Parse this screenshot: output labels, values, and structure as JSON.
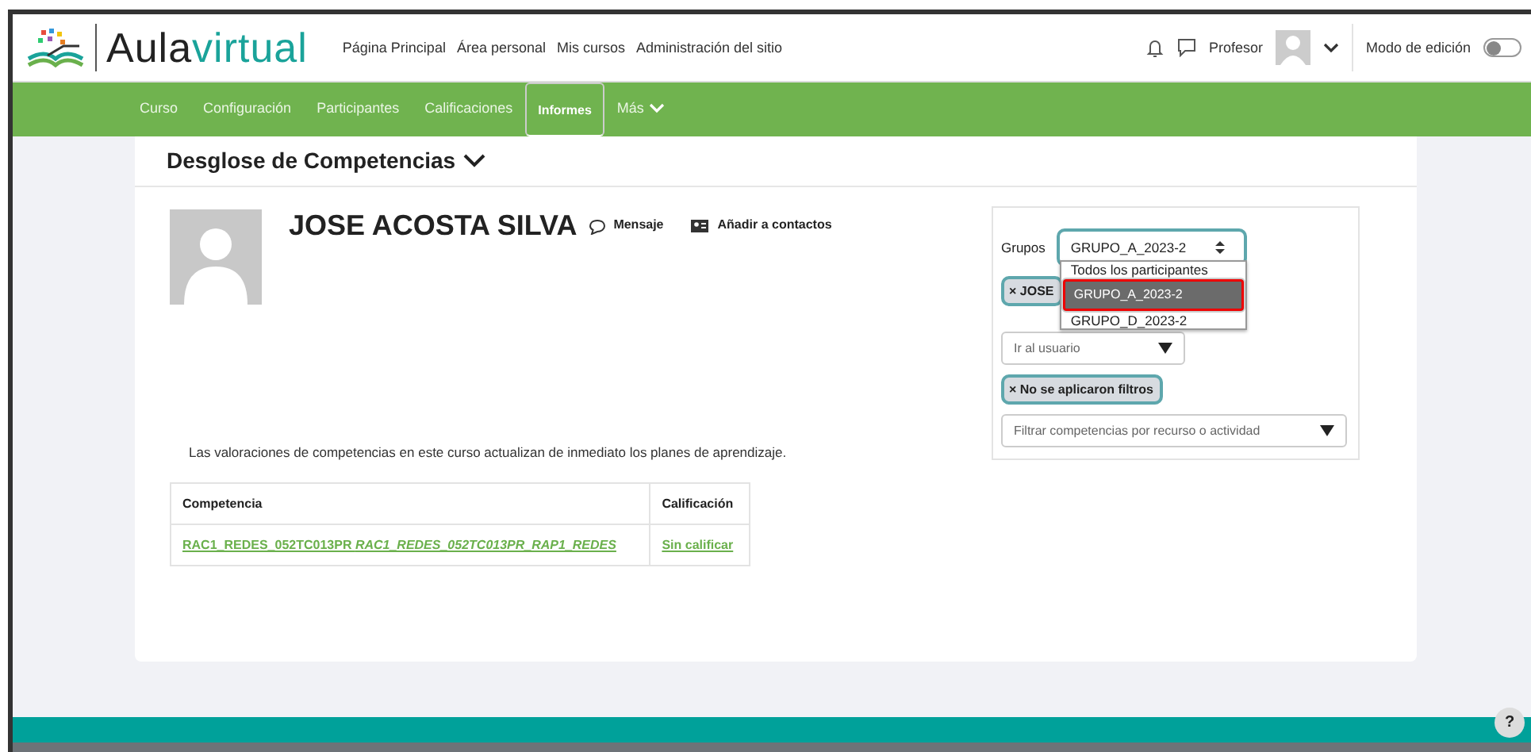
{
  "header": {
    "logo": {
      "part_1": "Aula",
      "part_2": "virtual"
    },
    "nav_links": [
      "Página Principal",
      "Área personal",
      "Mis cursos",
      "Administración del sitio"
    ],
    "user_name": "Profesor",
    "edit_mode": {
      "label": "Modo de edición",
      "on": false
    }
  },
  "course_nav": [
    {
      "label": "Curso",
      "selected": false
    },
    {
      "label": "Configuración",
      "selected": false
    },
    {
      "label": "Participantes",
      "selected": false
    },
    {
      "label": "Calificaciones",
      "selected": false
    },
    {
      "label": "Informes",
      "selected": true
    },
    {
      "label": "Más",
      "selected": false,
      "kind": "menu"
    }
  ],
  "page_title": "Desglose de Competencias",
  "profile": {
    "name": "JOSE ACOSTA SILVA",
    "actions": [
      {
        "kind": "message",
        "label": "Mensaje"
      },
      {
        "kind": "contact",
        "label": "Añadir a contactos"
      }
    ]
  },
  "filters": {
    "groups_label": "Grupos",
    "groups_value": "GRUPO_A_2023-2",
    "group_options": [
      {
        "label": "Todos los participantes",
        "selected": false
      },
      {
        "label": "GRUPO_A_2023-2",
        "selected": true
      },
      {
        "label": "GRUPO_D_2023-2",
        "selected": false
      }
    ],
    "user_chip": "× JOSE",
    "user_select": "Ir al usuario",
    "filter_chip": "× No se aplicaron filtros",
    "activity_select": "Filtrar competencias por recurso o actividad"
  },
  "notice": "Las valoraciones de competencias en este curso actualizan de inmediato los planes de aprendizaje.",
  "table": {
    "columns": [
      "Competencia",
      "Calificación"
    ],
    "rows": [
      {
        "competency": "RAC1_REDES_052TC013PR *RAC1_REDES_052TC013PR_RAP1_REDES*",
        "rating": "Sin calificar"
      }
    ]
  },
  "help_button": "?"
}
